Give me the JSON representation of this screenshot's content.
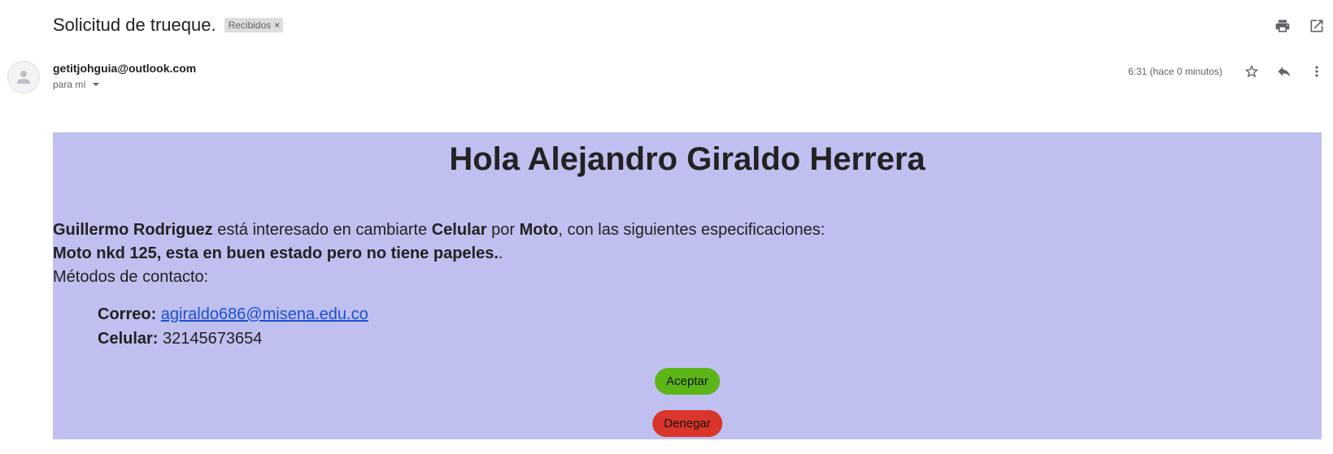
{
  "header": {
    "subject": "Solicitud de trueque.",
    "label": "Recibidos",
    "label_remove": "×",
    "icons": [
      "print-icon",
      "open-in-new-window-icon"
    ]
  },
  "message": {
    "sender": "getitjohguia@outlook.com",
    "to": "para mí",
    "time": "6:31 (hace 0 minutos)",
    "icons": [
      "star-icon",
      "reply-icon",
      "more-vert-icon",
      "avatar-person-icon",
      "chevron-down-icon"
    ]
  },
  "body": {
    "greeting": "Hola Alejandro Giraldo Herrera",
    "requester": "Guillermo Rodriguez",
    "text_interested": " está interesado en cambiarte ",
    "item_mine": "Celular",
    "text_for": " por ",
    "item_theirs": "Moto",
    "text_specs": ", con las siguientes especificaciones:",
    "specs": "Moto nkd 125, esta en buen estado pero no tiene papeles.",
    "specs_tail": ".",
    "contact_methods": "Métodos de contacto:",
    "email_label": "Correo:",
    "email_value": "agiraldo686@misena.edu.co",
    "phone_label": "Celular:",
    "phone_value": "32145673654",
    "accept_label": "Aceptar",
    "deny_label": "Denegar"
  },
  "colors": {
    "body_background": "#bfbff0",
    "accept": "#5cb517",
    "deny": "#d9352a",
    "link": "#1a4fd1"
  }
}
